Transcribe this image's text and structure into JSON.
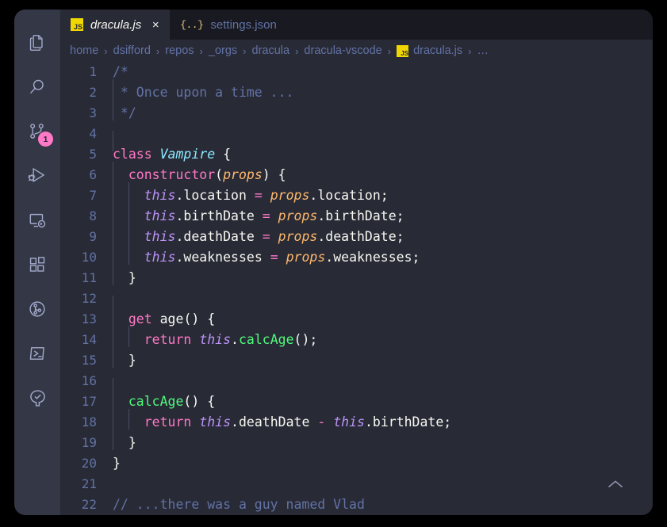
{
  "window": {
    "background": "#282A36",
    "shell_background": "#000000",
    "accent_pink": "#FF79C6",
    "accent_purple": "#BD93F9",
    "accent_green": "#50FA7B",
    "accent_cyan": "#8BE9FD",
    "accent_orange": "#FFB86C",
    "comment_color": "#6272A4",
    "foreground": "#F8F8F2",
    "activitybar_background": "#343746",
    "tabbar_background": "#191A21"
  },
  "activitybar": {
    "items": [
      {
        "name": "explorer",
        "icon": "files-icon",
        "badge": null
      },
      {
        "name": "search",
        "icon": "search-icon",
        "badge": null
      },
      {
        "name": "source-control",
        "icon": "source-control-icon",
        "badge": "1"
      },
      {
        "name": "run-and-debug",
        "icon": "run-debug-icon",
        "badge": null
      },
      {
        "name": "remote-explorer",
        "icon": "remote-explorer-icon",
        "badge": null
      },
      {
        "name": "extensions",
        "icon": "extensions-icon",
        "badge": null
      },
      {
        "name": "gitlens",
        "icon": "gitlens-icon",
        "badge": null
      },
      {
        "name": "terminal-powershell",
        "icon": "powershell-icon",
        "badge": null
      },
      {
        "name": "project-tree",
        "icon": "tree-check-icon",
        "badge": null
      }
    ]
  },
  "tabs": [
    {
      "label": "dracula.js",
      "icon": "js-file-icon",
      "icon_text": "JS",
      "active": true,
      "preview": true,
      "close_glyph": "×"
    },
    {
      "label": "settings.json",
      "icon": "json-file-icon",
      "icon_text": "{..}",
      "active": false,
      "preview": false
    }
  ],
  "breadcrumb": {
    "separator": "›",
    "items": [
      {
        "label": "home",
        "icon": null
      },
      {
        "label": "dsifford",
        "icon": null
      },
      {
        "label": "repos",
        "icon": null
      },
      {
        "label": "_orgs",
        "icon": null
      },
      {
        "label": "dracula",
        "icon": null
      },
      {
        "label": "dracula-vscode",
        "icon": null
      },
      {
        "label": "dracula.js",
        "icon": "js-file-icon",
        "icon_text": "JS"
      },
      {
        "label": "…",
        "icon": null
      }
    ]
  },
  "editor": {
    "language": "javascript",
    "filename": "dracula.js",
    "first_visible_line": 1,
    "last_visible_line": 22,
    "lines": [
      {
        "n": "1",
        "indent": 0,
        "tokens": [
          {
            "t": "com",
            "s": "/*"
          }
        ]
      },
      {
        "n": "2",
        "indent": 1,
        "tokens": [
          {
            "t": "com",
            "s": " * Once upon a time ..."
          }
        ]
      },
      {
        "n": "3",
        "indent": 1,
        "tokens": [
          {
            "t": "com",
            "s": " */"
          }
        ]
      },
      {
        "n": "4",
        "indent": 1,
        "tokens": []
      },
      {
        "n": "5",
        "indent": 0,
        "tokens": [
          {
            "t": "key",
            "s": "class"
          },
          {
            "t": "pun",
            "s": " "
          },
          {
            "t": "cls",
            "s": "Vampire"
          },
          {
            "t": "pun",
            "s": " {"
          }
        ]
      },
      {
        "n": "6",
        "indent": 1,
        "tokens": [
          {
            "t": "pun",
            "s": "  "
          },
          {
            "t": "key",
            "s": "constructor"
          },
          {
            "t": "pun",
            "s": "("
          },
          {
            "t": "par",
            "s": "props"
          },
          {
            "t": "pun",
            "s": ") {"
          }
        ]
      },
      {
        "n": "7",
        "indent": 2,
        "tokens": [
          {
            "t": "pun",
            "s": "    "
          },
          {
            "t": "this",
            "s": "this"
          },
          {
            "t": "var",
            "s": ".location"
          },
          {
            "t": "pun",
            "s": " "
          },
          {
            "t": "op",
            "s": "="
          },
          {
            "t": "pun",
            "s": " "
          },
          {
            "t": "par",
            "s": "props"
          },
          {
            "t": "var",
            "s": ".location;"
          }
        ]
      },
      {
        "n": "8",
        "indent": 2,
        "tokens": [
          {
            "t": "pun",
            "s": "    "
          },
          {
            "t": "this",
            "s": "this"
          },
          {
            "t": "var",
            "s": ".birthDate"
          },
          {
            "t": "pun",
            "s": " "
          },
          {
            "t": "op",
            "s": "="
          },
          {
            "t": "pun",
            "s": " "
          },
          {
            "t": "par",
            "s": "props"
          },
          {
            "t": "var",
            "s": ".birthDate;"
          }
        ]
      },
      {
        "n": "9",
        "indent": 2,
        "tokens": [
          {
            "t": "pun",
            "s": "    "
          },
          {
            "t": "this",
            "s": "this"
          },
          {
            "t": "var",
            "s": ".deathDate"
          },
          {
            "t": "pun",
            "s": " "
          },
          {
            "t": "op",
            "s": "="
          },
          {
            "t": "pun",
            "s": " "
          },
          {
            "t": "par",
            "s": "props"
          },
          {
            "t": "var",
            "s": ".deathDate;"
          }
        ]
      },
      {
        "n": "10",
        "indent": 2,
        "tokens": [
          {
            "t": "pun",
            "s": "    "
          },
          {
            "t": "this",
            "s": "this"
          },
          {
            "t": "var",
            "s": ".weaknesses"
          },
          {
            "t": "pun",
            "s": " "
          },
          {
            "t": "op",
            "s": "="
          },
          {
            "t": "pun",
            "s": " "
          },
          {
            "t": "par",
            "s": "props"
          },
          {
            "t": "var",
            "s": ".weaknesses;"
          }
        ]
      },
      {
        "n": "11",
        "indent": 1,
        "tokens": [
          {
            "t": "pun",
            "s": "  }"
          }
        ]
      },
      {
        "n": "12",
        "indent": 1,
        "tokens": []
      },
      {
        "n": "13",
        "indent": 1,
        "tokens": [
          {
            "t": "pun",
            "s": "  "
          },
          {
            "t": "key",
            "s": "get"
          },
          {
            "t": "pun",
            "s": " "
          },
          {
            "t": "var",
            "s": "age"
          },
          {
            "t": "pun",
            "s": "() {"
          }
        ]
      },
      {
        "n": "14",
        "indent": 2,
        "tokens": [
          {
            "t": "pun",
            "s": "    "
          },
          {
            "t": "key",
            "s": "return"
          },
          {
            "t": "pun",
            "s": " "
          },
          {
            "t": "this",
            "s": "this"
          },
          {
            "t": "pun",
            "s": "."
          },
          {
            "t": "fn",
            "s": "calcAge"
          },
          {
            "t": "pun",
            "s": "();"
          }
        ]
      },
      {
        "n": "15",
        "indent": 1,
        "tokens": [
          {
            "t": "pun",
            "s": "  }"
          }
        ]
      },
      {
        "n": "16",
        "indent": 1,
        "tokens": []
      },
      {
        "n": "17",
        "indent": 1,
        "tokens": [
          {
            "t": "pun",
            "s": "  "
          },
          {
            "t": "fn",
            "s": "calcAge"
          },
          {
            "t": "pun",
            "s": "() {"
          }
        ]
      },
      {
        "n": "18",
        "indent": 2,
        "tokens": [
          {
            "t": "pun",
            "s": "    "
          },
          {
            "t": "key",
            "s": "return"
          },
          {
            "t": "pun",
            "s": " "
          },
          {
            "t": "this",
            "s": "this"
          },
          {
            "t": "var",
            "s": ".deathDate"
          },
          {
            "t": "pun",
            "s": " "
          },
          {
            "t": "op",
            "s": "-"
          },
          {
            "t": "pun",
            "s": " "
          },
          {
            "t": "this",
            "s": "this"
          },
          {
            "t": "var",
            "s": ".birthDate;"
          }
        ]
      },
      {
        "n": "19",
        "indent": 1,
        "tokens": [
          {
            "t": "pun",
            "s": "  }"
          }
        ]
      },
      {
        "n": "20",
        "indent": 0,
        "tokens": [
          {
            "t": "pun",
            "s": "}"
          }
        ]
      },
      {
        "n": "21",
        "indent": 0,
        "tokens": []
      },
      {
        "n": "22",
        "indent": 0,
        "tokens": [
          {
            "t": "com",
            "s": "// ...there was a guy named Vlad"
          }
        ]
      }
    ]
  },
  "widgets": {
    "scroll_to_top": {
      "name": "chevron-up-icon",
      "glyph": "⌃"
    }
  }
}
